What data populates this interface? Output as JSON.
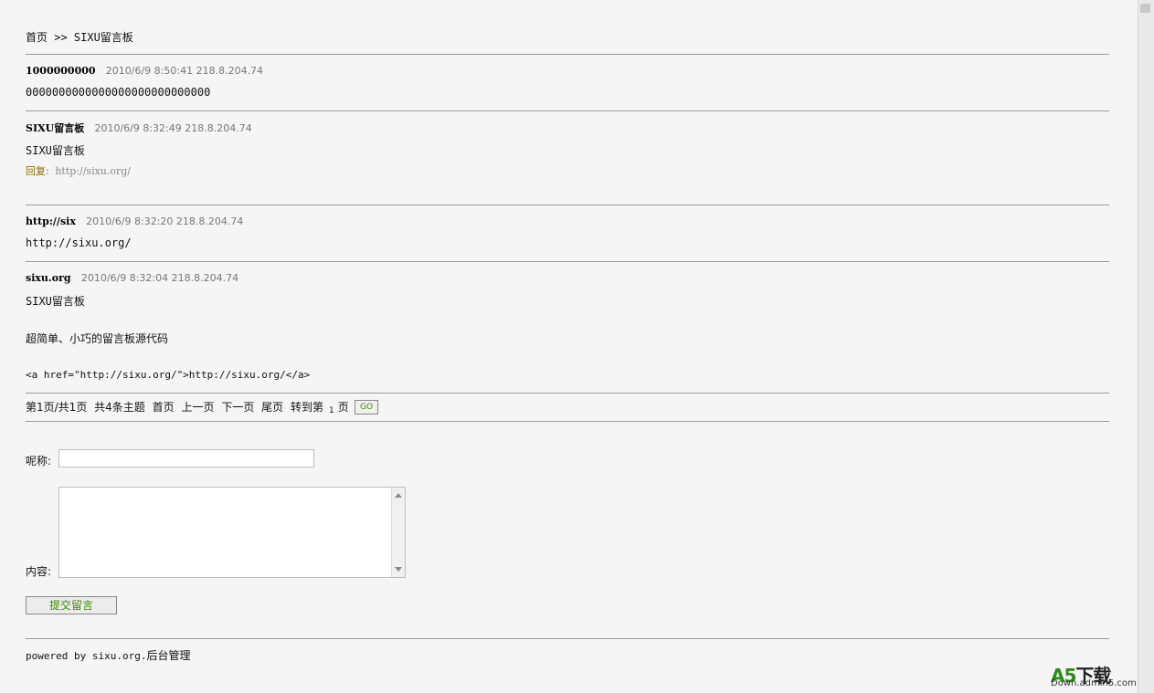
{
  "breadcrumb": "首页 >> SIXU留言板",
  "entries": [
    {
      "name": "1000000000",
      "meta": "2010/6/9 8:50:41 218.8.204.74",
      "body": "0000000000000000000000000000"
    },
    {
      "name": "SIXU留言板",
      "meta": "2010/6/9 8:32:49 218.8.204.74",
      "body": "SIXU留言板",
      "reply_label": "回复:",
      "reply_text": "http://sixu.org/"
    },
    {
      "name": "http://six",
      "meta": "2010/6/9 8:32:20 218.8.204.74",
      "body": "http://sixu.org/"
    },
    {
      "name": "sixu.org",
      "meta": "2010/6/9 8:32:04 218.8.204.74",
      "body_lines": [
        "SIXU留言板",
        "超简单、小巧的留言板源代码",
        "<a href=\"http://sixu.org/\">http://sixu.org/</a>"
      ]
    }
  ],
  "pager": {
    "status": "第1页/共1页",
    "total": "共4条主题",
    "first": "首页",
    "prev": "上一页",
    "next": "下一页",
    "last": "尾页",
    "goto_prefix": "转到第",
    "page_value": "1",
    "goto_suffix": "页",
    "go_label": "GO"
  },
  "form": {
    "name_label": "呢称:",
    "content_label": "内容:",
    "submit_label": "提交留言"
  },
  "footer": {
    "powered": "powered by sixu.org.",
    "admin_link": "后台管理"
  },
  "watermark": {
    "brand": "A5",
    "brand_suffix": "下载",
    "site": "Down.admin5.com"
  },
  "colors": {
    "background": "#f5f5f5",
    "reply_label": "#8a6d00",
    "button_text": "#3a8a00",
    "watermark_green": "#2d8a1a"
  }
}
